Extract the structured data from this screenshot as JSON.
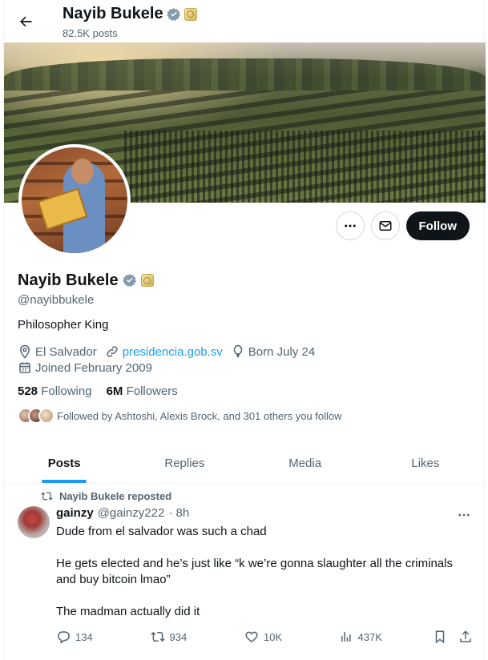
{
  "header": {
    "name": "Nayib Bukele",
    "posts_count": "82.5K posts"
  },
  "actions": {
    "follow_label": "Follow"
  },
  "profile": {
    "name": "Nayib Bukele",
    "handle": "@nayibbukele",
    "bio": "Philosopher King",
    "location": "El Salvador",
    "website": "presidencia.gob.sv",
    "birthday": "Born July 24",
    "joined": "Joined February 2009",
    "following_count": "528",
    "following_label": "Following",
    "followers_count": "6M",
    "followers_label": "Followers",
    "followed_by": "Followed by Ashtoshi, Alexis Brock, and 301 others you follow"
  },
  "tabs": [
    {
      "label": "Posts"
    },
    {
      "label": "Replies"
    },
    {
      "label": "Media"
    },
    {
      "label": "Likes"
    }
  ],
  "post": {
    "repost_label": "Nayib Bukele reposted",
    "author_name": "gainzy",
    "author_handle": "@gainzy222",
    "time": "· 8h",
    "text_lines": [
      "Dude from el salvador was such a chad",
      "He gets elected and he’s just like “k we’re gonna slaughter all the criminals and buy bitcoin lmao”",
      "The madman actually did it"
    ],
    "replies": "134",
    "reposts": "934",
    "likes": "10K",
    "views": "437K"
  },
  "colors": {
    "accent": "#1d9bf0",
    "text": "#0f1419",
    "muted": "#536471"
  }
}
